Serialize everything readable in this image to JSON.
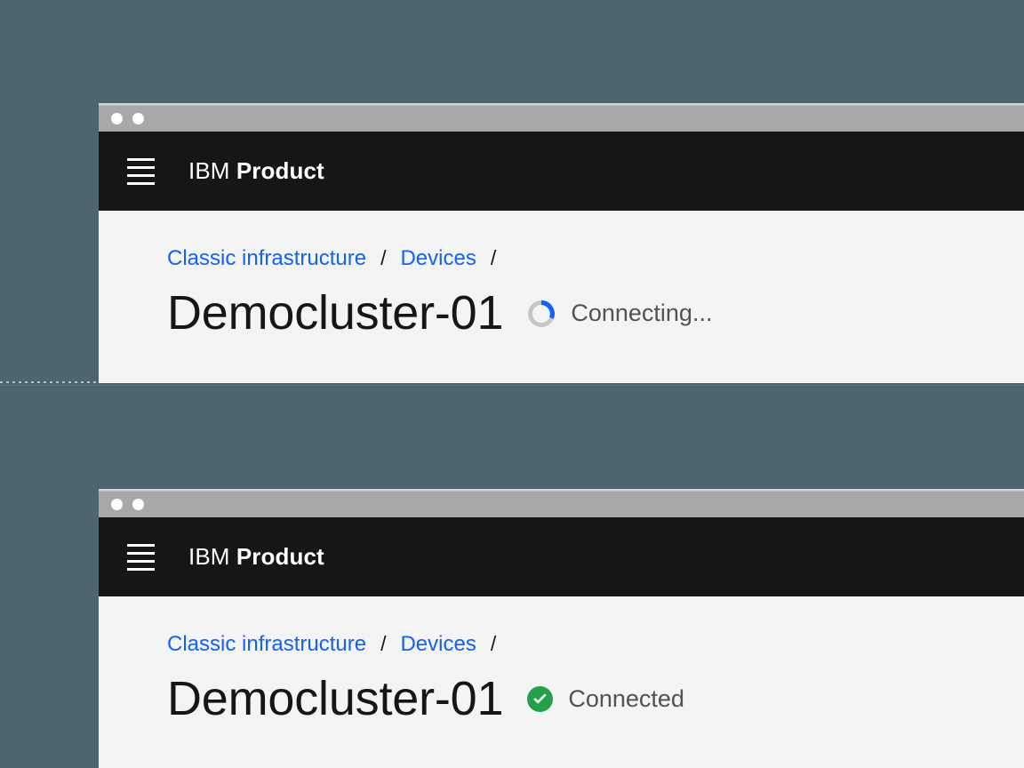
{
  "canvas": {
    "background_color": "#4c6670",
    "panel_background": "#f4f4f4",
    "titlebar_color": "#a8a8a8",
    "header_color": "#161616",
    "link_color": "#0f62fe",
    "success_color": "#24a148",
    "spinner_color": "#0f62fe"
  },
  "frames": [
    {
      "id": "connecting",
      "titlebar": {
        "dots": [
          "window-dot-1",
          "window-dot-2"
        ]
      },
      "header": {
        "menu_icon": "hamburger-menu-icon",
        "brand_prefix": "IBM",
        "brand_name": "Product"
      },
      "breadcrumb": {
        "items": [
          {
            "label": "Classic infrastructure",
            "href": true
          },
          {
            "label": "Devices",
            "href": true
          }
        ],
        "separator": "/",
        "trailing_separator": "/"
      },
      "page": {
        "title": "Democluster-01",
        "status": {
          "icon": "loading-spinner-icon",
          "label": "Connecting...",
          "state": "loading"
        }
      }
    },
    {
      "id": "connected",
      "titlebar": {
        "dots": [
          "window-dot-1",
          "window-dot-2"
        ]
      },
      "header": {
        "menu_icon": "hamburger-menu-icon",
        "brand_prefix": "IBM",
        "brand_name": "Product"
      },
      "breadcrumb": {
        "items": [
          {
            "label": "Classic infrastructure",
            "href": true
          },
          {
            "label": "Devices",
            "href": true
          }
        ],
        "separator": "/",
        "trailing_separator": "/"
      },
      "page": {
        "title": "Democluster-01",
        "status": {
          "icon": "checkmark-filled-icon",
          "label": "Connected",
          "state": "success"
        }
      }
    }
  ]
}
